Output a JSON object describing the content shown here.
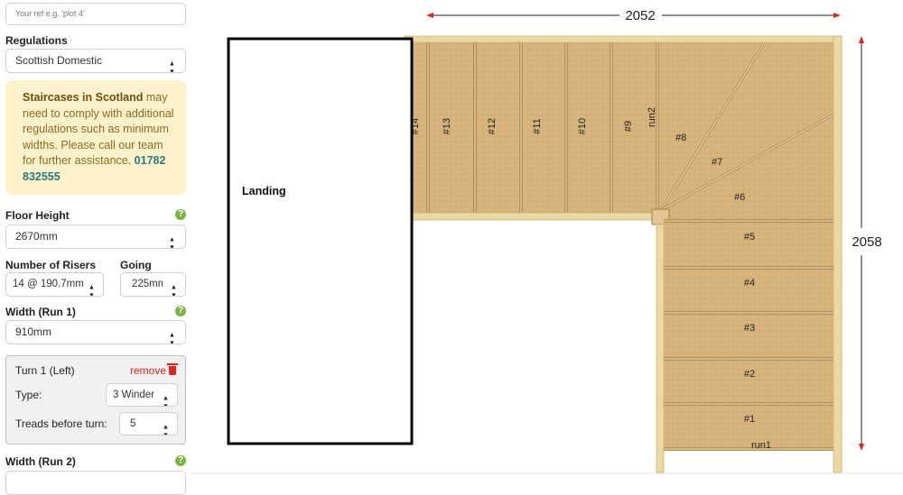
{
  "form": {
    "ref_placeholder": "Your ref e.g. 'plot 4'",
    "regulations": {
      "label": "Regulations",
      "value": "Scottish Domestic"
    },
    "notice": {
      "bold": "Staircases in Scotland",
      "text": " may need to comply with additional regulations such as minimum widths. Please call our team for further assistance. ",
      "phone": "01782 832555"
    },
    "floor_height": {
      "label": "Floor Height",
      "value": "2670mm",
      "help": "?"
    },
    "risers": {
      "label": "Number of Risers",
      "value": "14 @ 190.7mm"
    },
    "going": {
      "label": "Going",
      "value": "225mm"
    },
    "width_run1": {
      "label": "Width (Run 1)",
      "value": "910mm",
      "help": "?"
    },
    "turn": {
      "title": "Turn 1",
      "side": " (Left)",
      "remove": "remove",
      "type_label": "Type:",
      "type_value": "3 Winder",
      "treads_label": "Treads before turn:",
      "treads_value": "5"
    },
    "width_run2": {
      "label": "Width (Run 2)",
      "help": "?"
    }
  },
  "drawing": {
    "width_dim": "2052",
    "height_dim": "2058",
    "landing": "Landing",
    "run1_label": "run1",
    "run2_label": "run2",
    "run2_treads": [
      "#9",
      "#10",
      "#11",
      "#12",
      "#13",
      "#14"
    ],
    "winders": [
      "#8",
      "#7",
      "#6"
    ],
    "run1_treads": [
      "#5",
      "#4",
      "#3",
      "#2",
      "#1"
    ],
    "colors": {
      "wood": "#d8b57d",
      "frame": "#e8d9a4",
      "arrow": "#e02424"
    }
  }
}
